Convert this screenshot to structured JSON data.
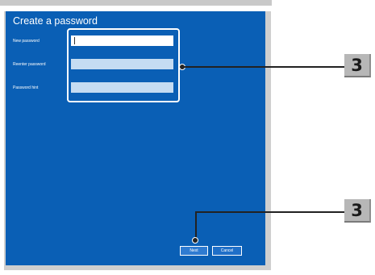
{
  "dialog": {
    "title": "Create a password",
    "fields": [
      {
        "label": "New password",
        "value": "",
        "state": "active"
      },
      {
        "label": "Reenter password",
        "value": "",
        "state": "inactive"
      },
      {
        "label": "Password hint",
        "value": "",
        "state": "inactive"
      }
    ],
    "buttons": {
      "next": "Next",
      "cancel": "Cancel"
    }
  },
  "callouts": [
    {
      "number": "3",
      "target": "password-fields"
    },
    {
      "number": "3",
      "target": "next-button"
    }
  ],
  "colors": {
    "dialog_background": "#0a5fb5",
    "input_active": "#ffffff",
    "input_inactive": "#c5dcf2",
    "badge_background": "#b7b7b7"
  }
}
